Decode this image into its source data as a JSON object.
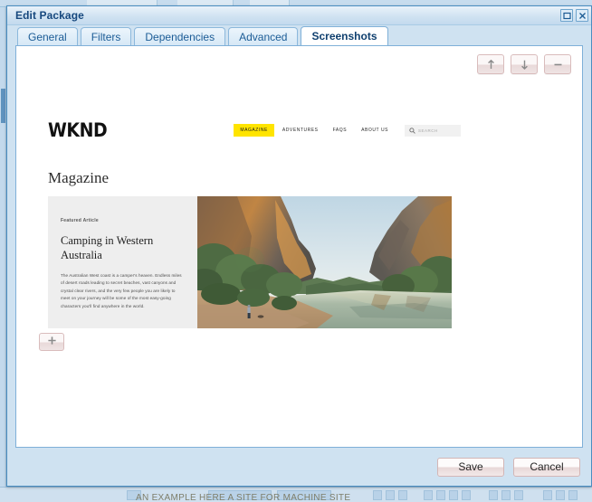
{
  "window": {
    "title": "Edit Package",
    "buttons": {
      "maximize": "maximize-icon",
      "close": "close-icon"
    }
  },
  "tabs": [
    {
      "label": "General",
      "active": false
    },
    {
      "label": "Filters",
      "active": false
    },
    {
      "label": "Dependencies",
      "active": false
    },
    {
      "label": "Advanced",
      "active": false
    },
    {
      "label": "Screenshots",
      "active": true
    }
  ],
  "screenshot_toolbar": [
    {
      "name": "move-up-button",
      "icon": "arrow-up-icon",
      "label": "↑"
    },
    {
      "name": "move-down-button",
      "icon": "arrow-down-icon",
      "label": "↓"
    },
    {
      "name": "remove-screenshot-button",
      "icon": "minus-icon",
      "label": "−"
    }
  ],
  "add_button": {
    "name": "add-screenshot-button",
    "icon": "plus-icon",
    "label": "+"
  },
  "preview": {
    "logo": "WKND",
    "nav": [
      {
        "label": "MAGAZINE",
        "active": true
      },
      {
        "label": "ADVENTURES",
        "active": false
      },
      {
        "label": "FAQS",
        "active": false
      },
      {
        "label": "ABOUT US",
        "active": false
      }
    ],
    "search_placeholder": "SEARCH",
    "page_title": "Magazine",
    "card": {
      "eyebrow": "Featured Article",
      "headline": "Camping in Western Australia",
      "body": "The Australian West coast is a camper's heaven. Endless miles of desert roads leading to secret beaches, vast canyons and crystal clear rivers, and the very few people you are likely to meet on your journey will be some of the most easy-going characters you'll find anywhere in the world.",
      "image_alt": "Windjana Gorge canyon with river and cliffs"
    }
  },
  "footer": {
    "save_label": "Save",
    "cancel_label": "Cancel"
  },
  "colors": {
    "titlebar_text": "#16487e",
    "tab_text": "#1c5c96",
    "accent_yellow": "#ffe400",
    "dialog_bg": "#cfe2f1",
    "button_border": "#d9bcbc"
  },
  "background": {
    "text_sliver": "AN EXAMPLE HERE A SITE FOR MACHINE SITE"
  }
}
